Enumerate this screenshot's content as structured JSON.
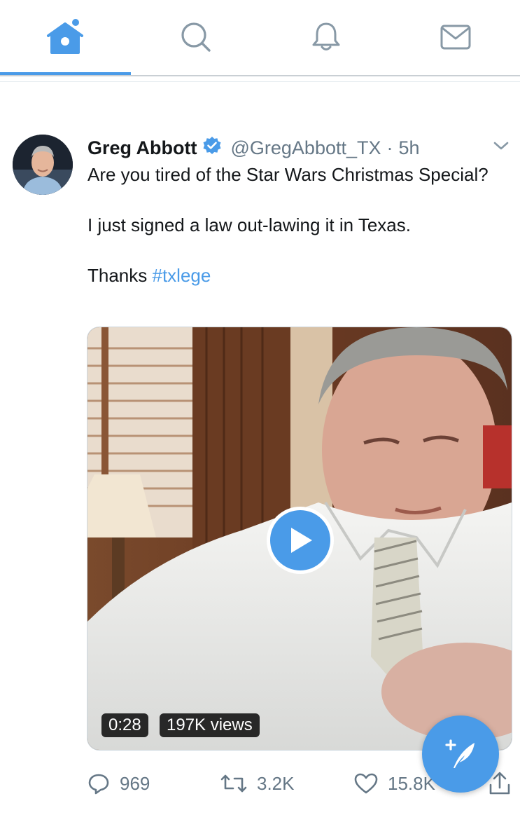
{
  "nav": {
    "tabs": [
      {
        "name": "home",
        "icon": "home-icon",
        "active": true
      },
      {
        "name": "search",
        "icon": "search-icon",
        "active": false
      },
      {
        "name": "notifications",
        "icon": "bell-icon",
        "active": false
      },
      {
        "name": "messages",
        "icon": "mail-icon",
        "active": false
      }
    ],
    "accent_color": "#4a9be8"
  },
  "tweet": {
    "display_name": "Greg Abbott",
    "verified": true,
    "handle": "@GregAbbott_TX",
    "separator": "·",
    "time": "5h",
    "text_line1": "Are you tired of the Star Wars Christmas Special?",
    "text_line2": "I just signed a law out-lawing it in Texas.",
    "text_line3_prefix": "Thanks ",
    "hashtag": "#txlege",
    "video": {
      "duration": "0:28",
      "views": "197K views"
    },
    "actions": {
      "replies": "969",
      "retweets": "3.2K",
      "likes": "15.8K"
    }
  },
  "colors": {
    "link": "#4a9be8",
    "muted": "#657786",
    "text": "#14171a"
  }
}
